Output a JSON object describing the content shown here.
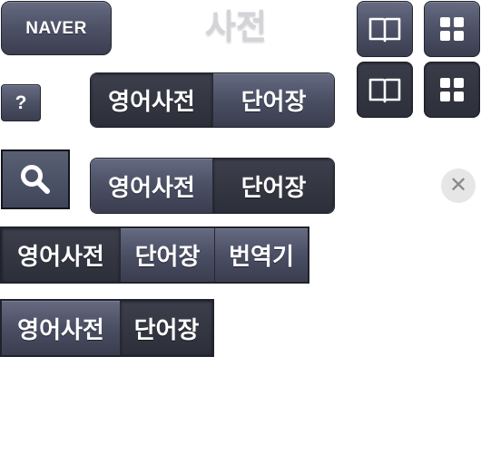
{
  "logo": {
    "label": "NAVER"
  },
  "title": "사전",
  "help_button": {
    "label": "?"
  },
  "icons": {
    "book": "book-icon",
    "grid": "grid-icon",
    "search": "search-icon",
    "close": "close-icon"
  },
  "segmented_controls": [
    {
      "items": [
        "영어사전",
        "단어장"
      ],
      "active_index": 0
    },
    {
      "items": [
        "영어사전",
        "단어장"
      ],
      "active_index": 1
    },
    {
      "items": [
        "영어사전",
        "단어장",
        "번역기"
      ],
      "active_index": 0
    },
    {
      "items": [
        "영어사전",
        "단어장"
      ],
      "active_index": 1
    }
  ],
  "close_button": {
    "label": "✕"
  },
  "colors": {
    "button_dark": "#4d5166",
    "button_active": "#2d2f3a",
    "title_gray": "#d3d4d8",
    "close_bg": "#e6e6e6",
    "close_glyph": "#8a8a8a"
  }
}
